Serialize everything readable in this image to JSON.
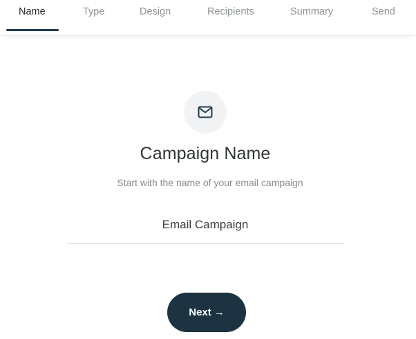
{
  "tabs": [
    {
      "label": "Name",
      "active": true
    },
    {
      "label": "Type",
      "active": false
    },
    {
      "label": "Design",
      "active": false
    },
    {
      "label": "Recipients",
      "active": false
    },
    {
      "label": "Summary",
      "active": false
    },
    {
      "label": "Send",
      "active": false
    }
  ],
  "main": {
    "icon": "mail-icon",
    "title": "Campaign Name",
    "subtitle": "Start with the name of your email campaign",
    "campaign_name_value": "Email Campaign",
    "next_label": "Next",
    "next_arrow": "→"
  },
  "colors": {
    "accent": "#1d3341",
    "active_tab_underline": "#1e3a4a",
    "icon_circle_bg": "#f1f3f5"
  }
}
